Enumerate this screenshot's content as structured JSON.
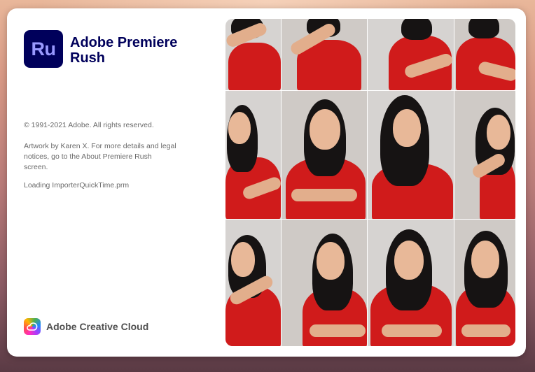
{
  "app": {
    "logo_text": "Ru",
    "name": "Adobe Premiere Rush",
    "logo_color": "#00005b",
    "logo_text_color": "#9999ff"
  },
  "legal": {
    "copyright": "© 1991-2021 Adobe. All rights reserved.",
    "artwork": "Artwork by Karen X. For more details and legal notices, go to the About Premiere Rush screen."
  },
  "status": {
    "loading": "Loading ImporterQuickTime.prm"
  },
  "footer": {
    "brand_label": "Adobe Creative Cloud",
    "icon": "creative-cloud-icon"
  },
  "artwork_grid": {
    "rows": 3,
    "columns": 4,
    "shirt_color": "#d01b1b"
  }
}
